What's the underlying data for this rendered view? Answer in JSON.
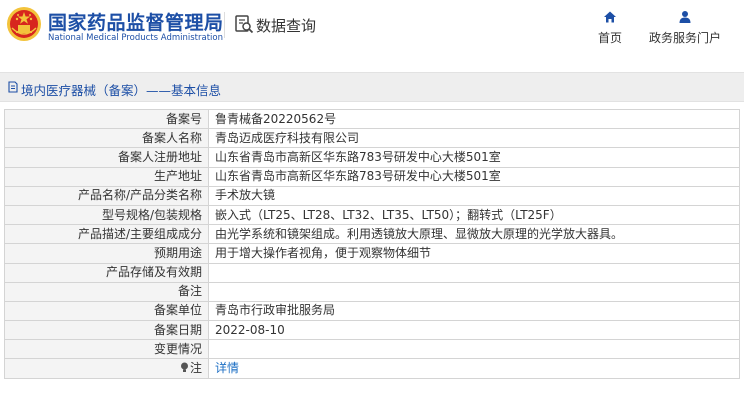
{
  "header": {
    "brand_cn": "国家药品监督管理局",
    "brand_en": "National Medical Products Administration",
    "site_search": "数据查询",
    "nav": [
      {
        "label": "首页",
        "icon": "home-icon"
      },
      {
        "label": "政务服务门户",
        "icon": "user-icon"
      }
    ]
  },
  "section": {
    "title": "境内医疗器械（备案）——基本信息",
    "icon": "document-icon"
  },
  "rows": [
    {
      "label": "备案号",
      "value": "鲁青械备20220562号"
    },
    {
      "label": "备案人名称",
      "value": "青岛迈成医疗科技有限公司"
    },
    {
      "label": "备案人注册地址",
      "value": "山东省青岛市高新区华东路783号研发中心大楼501室"
    },
    {
      "label": "生产地址",
      "value": "山东省青岛市高新区华东路783号研发中心大楼501室"
    },
    {
      "label": "产品名称/产品分类名称",
      "value": "手术放大镜"
    },
    {
      "label": "型号规格/包装规格",
      "value": "嵌入式（LT25、LT28、LT32、LT35、LT50）；翻转式（LT25F）"
    },
    {
      "label": "产品描述/主要组成成分",
      "value": "由光学系统和镜架组成。利用透镜放大原理、显微放大原理的光学放大器具。"
    },
    {
      "label": "预期用途",
      "value": "用于增大操作者视角，便于观察物体细节"
    },
    {
      "label": "产品存储及有效期",
      "value": ""
    },
    {
      "label": "备注",
      "value": ""
    },
    {
      "label": "备案单位",
      "value": "青岛市行政审批服务局"
    },
    {
      "label": "备案日期",
      "value": "2022-08-10"
    },
    {
      "label": "变更情况",
      "value": ""
    },
    {
      "label": "注",
      "value": "详情",
      "icon": "lightbulb-icon"
    }
  ],
  "colors": {
    "brand": "#1d4fa6",
    "link": "#1d6fc4",
    "emblem_red": "#d7261e",
    "emblem_gold": "#f3c33b"
  }
}
